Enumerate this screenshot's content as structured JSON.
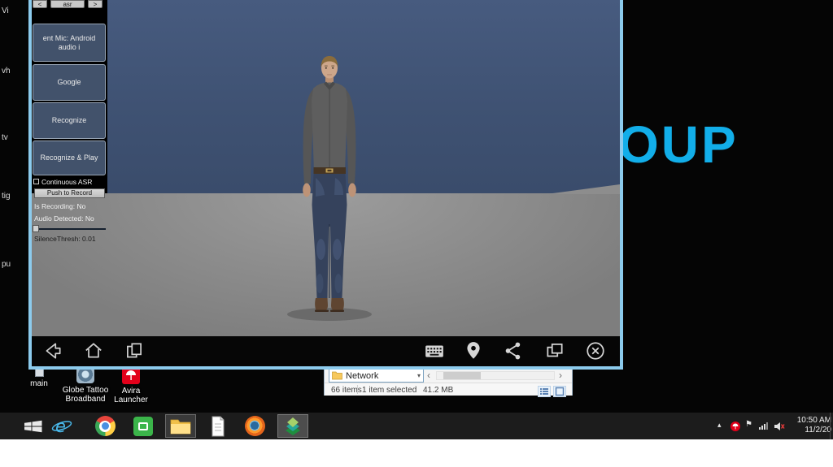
{
  "wallpaper": {
    "text": "OUP",
    "accent_color": "#12aee9"
  },
  "desktop": {
    "icon_label_fragments": [
      "Vi",
      "vh",
      "tv",
      "tig",
      "pu"
    ],
    "icons": [
      {
        "label": "main"
      },
      {
        "label": "Globe Tattoo Broadband"
      },
      {
        "label": "Avira Launcher"
      }
    ]
  },
  "emulator": {
    "border_color": "#8ccbed",
    "tabs": {
      "back": "<",
      "title": "asr",
      "forward": ">"
    },
    "asr_panel": {
      "mic_button": "ent Mic: Android audio i",
      "google_button": "Google",
      "recognize_button": "Recognize",
      "recognize_play_button": "Recognize & Play",
      "continuous_asr_label": "Continuous ASR",
      "push_to_record_button": "Push to Record",
      "is_recording": "Is Recording: No",
      "audio_detected": "Audio Detected: No",
      "silence_thresh": "SilenceThresh: 0.01"
    },
    "scene_colors": {
      "backdrop": "#3f5273",
      "floor": "#8a8a8a"
    },
    "navbar_icons": [
      "back",
      "home",
      "recents",
      "keyboard",
      "location",
      "share",
      "multi-window",
      "close"
    ]
  },
  "explorer": {
    "address": "Network",
    "status_items": "66 items",
    "status_selected": "1 item selected",
    "status_size": "41.2 MB"
  },
  "taskbar": {
    "app_icons": [
      "start",
      "internet-explorer",
      "chrome",
      "green-app",
      "file-explorer",
      "document",
      "firefox",
      "bluestacks"
    ],
    "tray_icons": [
      "hidden-icons",
      "avira",
      "action-center",
      "network",
      "volume-muted"
    ],
    "clock_time": "10:50 AM",
    "clock_date": "11/2/20",
    "avira_red": "#e2001a"
  }
}
